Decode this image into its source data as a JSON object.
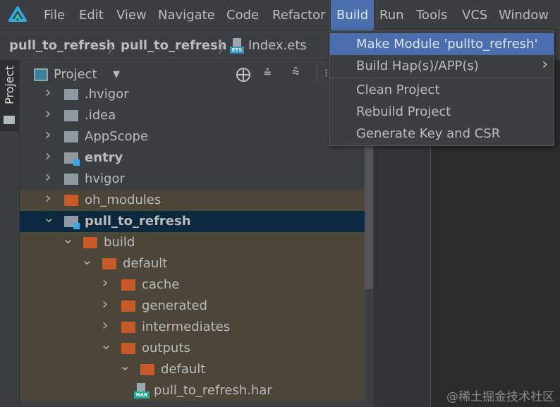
{
  "menubar": {
    "items": [
      {
        "label": "File"
      },
      {
        "label": "Edit"
      },
      {
        "label": "View"
      },
      {
        "label": "Navigate"
      },
      {
        "label": "Code"
      },
      {
        "label": "Refactor"
      },
      {
        "label": "Build",
        "active": true
      },
      {
        "label": "Run"
      },
      {
        "label": "Tools"
      },
      {
        "label": "VCS"
      },
      {
        "label": "Window"
      }
    ]
  },
  "breadcrumb": {
    "items": [
      "pull_to_refresh",
      "pull_to_refresh",
      "Index.ets"
    ],
    "file_badge": "ETS"
  },
  "side_tab": {
    "label": "Project"
  },
  "panel": {
    "title": "Project",
    "view_mode": "Project"
  },
  "tree": [
    {
      "label": ".hvigor",
      "depth": 0,
      "expanded": false,
      "type": "folder"
    },
    {
      "label": ".idea",
      "depth": 0,
      "expanded": false,
      "type": "folder"
    },
    {
      "label": "AppScope",
      "depth": 0,
      "expanded": false,
      "type": "folder"
    },
    {
      "label": "entry",
      "depth": 0,
      "expanded": false,
      "type": "module",
      "bold": true
    },
    {
      "label": "hvigor",
      "depth": 0,
      "expanded": false,
      "type": "folder"
    },
    {
      "label": "oh_modules",
      "depth": 0,
      "expanded": false,
      "type": "excluded",
      "hl": true
    },
    {
      "label": "pull_to_refresh",
      "depth": 0,
      "expanded": true,
      "type": "module",
      "bold": true,
      "selected": true
    },
    {
      "label": "build",
      "depth": 1,
      "expanded": true,
      "type": "excluded",
      "hl": true
    },
    {
      "label": "default",
      "depth": 2,
      "expanded": true,
      "type": "excluded",
      "hl": true
    },
    {
      "label": "cache",
      "depth": 3,
      "expanded": false,
      "type": "excluded",
      "hl": true
    },
    {
      "label": "generated",
      "depth": 3,
      "expanded": false,
      "type": "excluded",
      "hl": true
    },
    {
      "label": "intermediates",
      "depth": 3,
      "expanded": false,
      "type": "excluded",
      "hl": true
    },
    {
      "label": "outputs",
      "depth": 3,
      "expanded": true,
      "type": "excluded",
      "hl": true
    },
    {
      "label": "default",
      "depth": 4,
      "expanded": true,
      "type": "excluded",
      "hl": true
    },
    {
      "label": "pull_to_refresh.har",
      "depth": 5,
      "type": "har",
      "hl": true
    }
  ],
  "har_badge": "HAR",
  "build_menu": {
    "items": [
      {
        "label": "Make Module 'pullto_refresh'",
        "active": true
      },
      {
        "label": "Build Hap(s)/APP(s)",
        "submenu": true
      },
      {
        "label": "Clean Project",
        "separator_before": true
      },
      {
        "label": "Rebuild Project"
      },
      {
        "label": "Generate Key and CSR"
      }
    ]
  },
  "watermark": "@稀土掘金技术社区",
  "colors": {
    "accent": "#4b6eaf",
    "selection": "#0d293e",
    "excluded_bg": "#4a4638",
    "folder": "#c75a27"
  }
}
